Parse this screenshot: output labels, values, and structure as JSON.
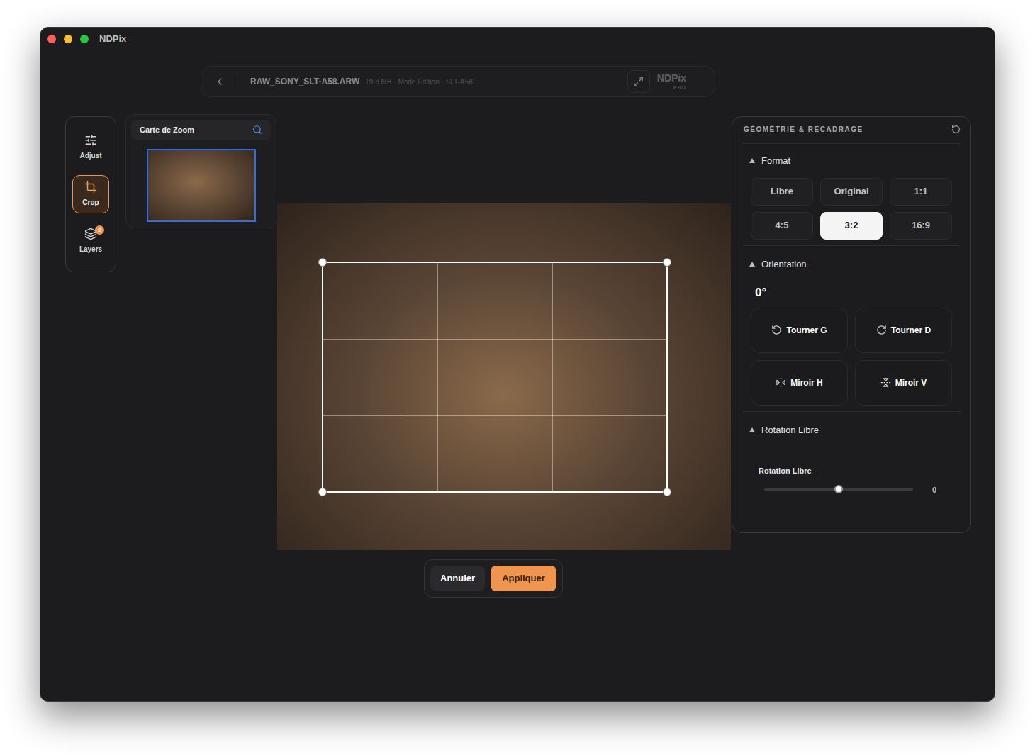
{
  "window": {
    "title": "NDPix"
  },
  "toolbar": {
    "file_name": "RAW_SONY_SLT-A58.ARW",
    "file_info": "19.8 MB · Mode Édition · SLT-A58",
    "logo": "NDPix",
    "logo_badge": "PRO"
  },
  "tools": [
    {
      "label": "Adjust",
      "selected": false,
      "badge": ""
    },
    {
      "label": "Crop",
      "selected": true,
      "badge": ""
    },
    {
      "label": "Layers",
      "selected": false,
      "badge": "2"
    }
  ],
  "zoom_map": {
    "title": "Carte de Zoom"
  },
  "crop_actions": [
    {
      "label": "Annuler",
      "kind": "secondary"
    },
    {
      "label": "Appliquer",
      "kind": "primary"
    }
  ],
  "panel": {
    "title": "GÉOMÉTRIE & RECADRAGE",
    "sections": [
      {
        "kind": "format",
        "title": "Format",
        "expanded": true,
        "options": [
          {
            "label": "Libre",
            "selected": false
          },
          {
            "label": "Original",
            "selected": false
          },
          {
            "label": "1:1",
            "selected": false
          },
          {
            "label": "4:5",
            "selected": false
          },
          {
            "label": "3:2",
            "selected": true
          },
          {
            "label": "16:9",
            "selected": false
          }
        ]
      },
      {
        "kind": "orientation",
        "title": "Orientation",
        "expanded": true,
        "angle": "0°",
        "actions": [
          "Tourner G",
          "Tourner D",
          "Miroir H",
          "Miroir V"
        ]
      },
      {
        "kind": "slider",
        "title": "Rotation Libre",
        "expanded": true,
        "slider": {
          "label": "Rotation Libre",
          "level": 0.5,
          "reading": "0"
        }
      }
    ]
  }
}
